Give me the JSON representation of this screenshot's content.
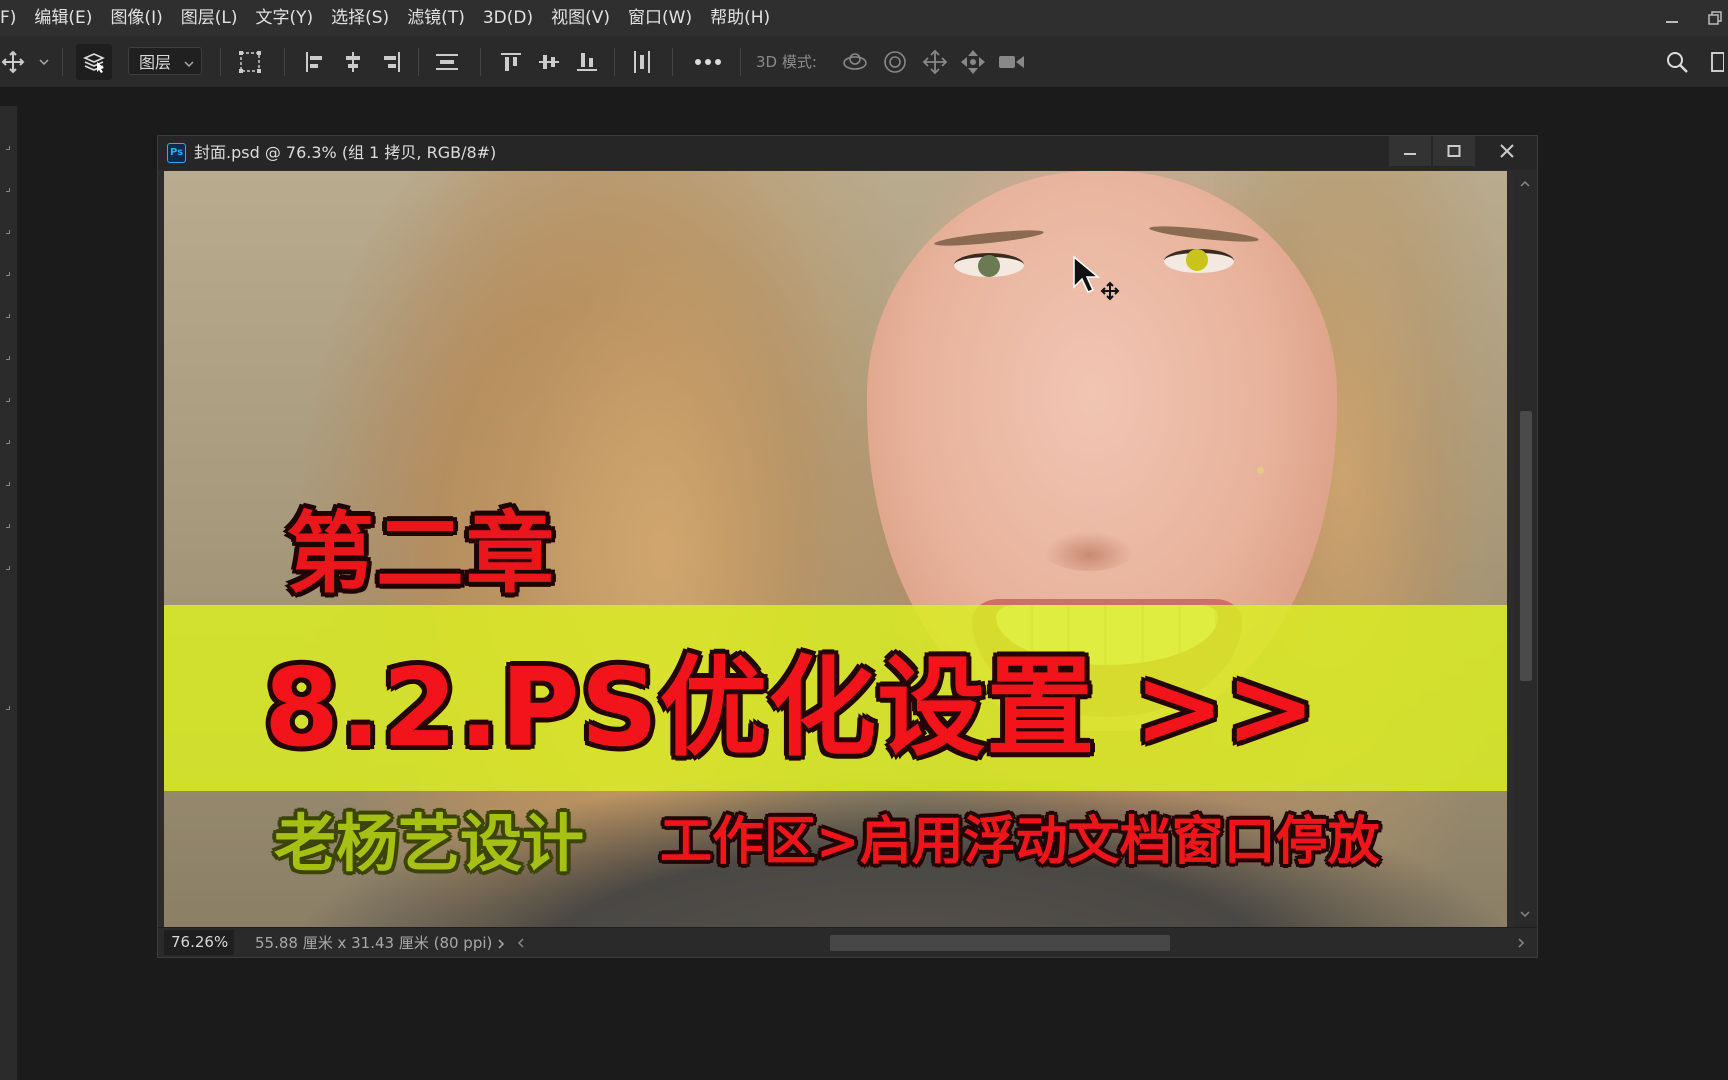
{
  "menu": [
    "F)",
    "编辑(E)",
    "图像(I)",
    "图层(L)",
    "文字(Y)",
    "选择(S)",
    "滤镜(T)",
    "3D(D)",
    "视图(V)",
    "窗口(W)",
    "帮助(H)"
  ],
  "options": {
    "layer_select_value": "图层",
    "mode_label": "3D 模式:"
  },
  "document": {
    "title": "封面.psd @ 76.3% (组 1 拷贝, RGB/8#)",
    "icon_label": "Ps",
    "zoom": "76.26%",
    "size_info": "55.88 厘米 x 31.43 厘米 (80 ppi)"
  },
  "cover": {
    "chapter": "第二章",
    "main_title": "8.2.PS优化设置 >>",
    "author": "老杨艺设计",
    "path": "工作区>启用浮动文档窗口停放"
  },
  "colors": {
    "banner": "#daec24",
    "title_red": "#f2141a",
    "author_green": "#a6c014",
    "ui_dark": "#1b1b1b"
  }
}
